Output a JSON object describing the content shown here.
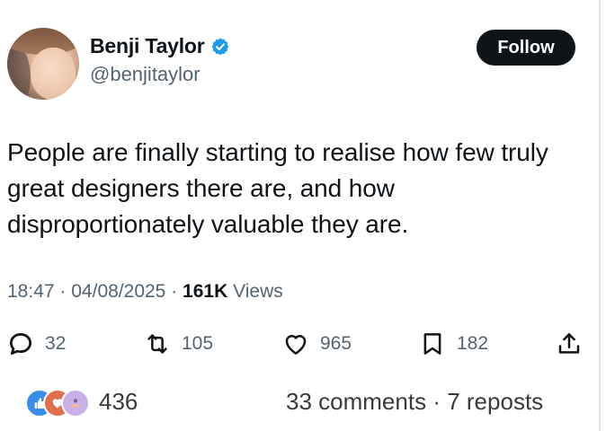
{
  "author": {
    "display_name": "Benji Taylor",
    "handle": "@benjitaylor",
    "verified": true
  },
  "follow_button": {
    "label": "Follow"
  },
  "post": {
    "text": "People are finally starting to realise how few truly great designers there are, and how disproportionately valuable they are.",
    "time": "18:47",
    "date": "04/08/2025",
    "views_count": "161K",
    "views_label": "Views",
    "separator": "·"
  },
  "actions": {
    "replies": "32",
    "reposts": "105",
    "likes": "965",
    "bookmarks": "182"
  },
  "footer": {
    "reaction_count": "436",
    "comments": "33 comments",
    "reposts": "7 reposts",
    "separator": "·"
  },
  "colors": {
    "text": "#0f1419",
    "muted": "#536471",
    "verified": "#1d9bf0",
    "button_bg": "#0f1419",
    "like_reaction": "#378fe9",
    "love_reaction": "#df704d",
    "support_reaction": "#c9b1e8"
  },
  "icons": [
    "verified-badge-icon",
    "reply-icon",
    "repost-icon",
    "like-icon",
    "bookmark-icon",
    "share-icon",
    "like-reaction-icon",
    "love-reaction-icon",
    "support-reaction-icon"
  ]
}
